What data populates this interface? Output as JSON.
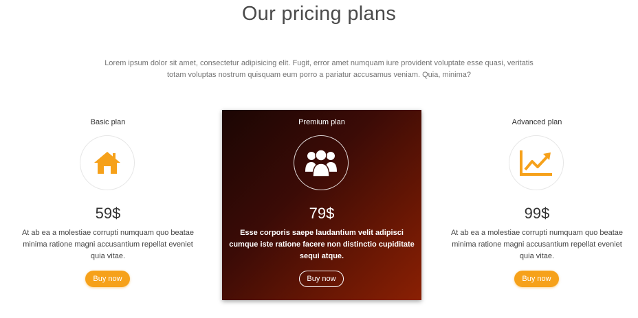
{
  "section": {
    "title": "Our pricing plans",
    "intro": "Lorem ipsum dolor sit amet, consectetur adipisicing elit. Fugit, error amet numquam iure provident voluptate esse quasi, veritatis totam voluptas nostrum quisquam eum porro a pariatur accusamus veniam. Quia, minima?"
  },
  "colors": {
    "accent": "#f6a11a",
    "premium_dark": "#1b0604",
    "premium_light": "#8a2004"
  },
  "plans": [
    {
      "name": "Basic plan",
      "icon": "home-icon",
      "price": "59$",
      "description": "At ab ea a molestiae corrupti numquam quo beatae minima ratione magni accusantium repellat eveniet quia vitae.",
      "button": "Buy now"
    },
    {
      "name": "Premium plan",
      "icon": "users-icon",
      "price": "79$",
      "description": "Esse corporis saepe laudantium velit adipisci cumque iste ratione facere non distinctio cupiditate sequi atque.",
      "button": "Buy now"
    },
    {
      "name": "Advanced plan",
      "icon": "chart-line-icon",
      "price": "99$",
      "description": "At ab ea a molestiae corrupti numquam quo beatae minima ratione magni accusantium repellat eveniet quia vitae.",
      "button": "Buy now"
    }
  ]
}
